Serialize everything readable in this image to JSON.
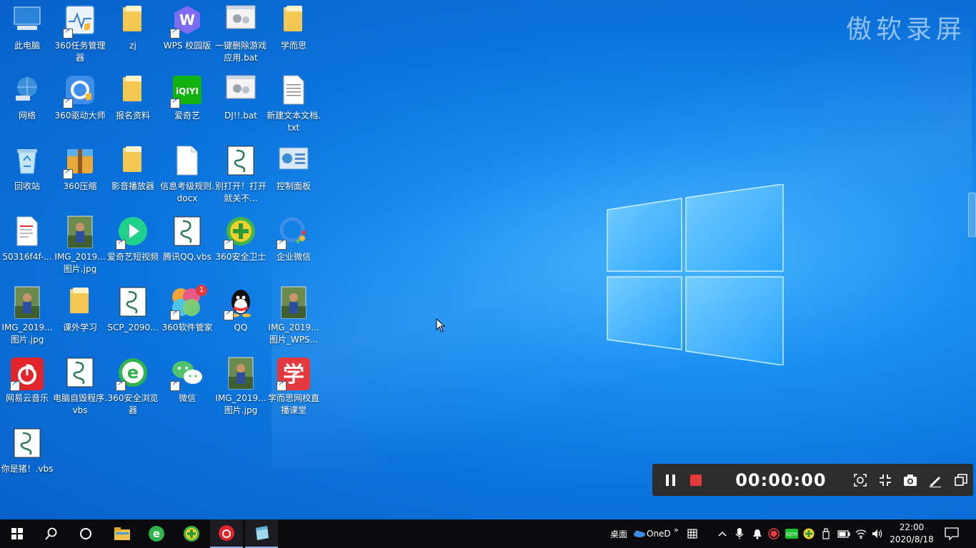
{
  "watermark": "傲软录屏",
  "icons": [
    {
      "label": "此电脑",
      "icon": "computer-icon"
    },
    {
      "label": "360任务管理器",
      "icon": "task-manager-icon"
    },
    {
      "label": "zj",
      "icon": "folder-icon"
    },
    {
      "label": "WPS 校园版",
      "icon": "wps-icon"
    },
    {
      "label": "一键删除游戏应用.bat",
      "icon": "bat-icon"
    },
    {
      "label": "学而思",
      "icon": "folder-icon"
    },
    {
      "label": "网络",
      "icon": "network-icon"
    },
    {
      "label": "360驱动大师",
      "icon": "driver-icon"
    },
    {
      "label": "报名资料",
      "icon": "folder-icon"
    },
    {
      "label": "爱奇艺",
      "icon": "iqiyi-icon"
    },
    {
      "label": "DJ!!.bat",
      "icon": "bat-icon"
    },
    {
      "label": "新建文本文档.txt",
      "icon": "txt-icon"
    },
    {
      "label": "回收站",
      "icon": "recycle-bin-icon"
    },
    {
      "label": "360压缩",
      "icon": "zip-icon"
    },
    {
      "label": "影音播放器",
      "icon": "folder-icon"
    },
    {
      "label": "信息考级规则.docx",
      "icon": "doc-icon"
    },
    {
      "label": "别打开！打开就关不...",
      "icon": "vbs-icon"
    },
    {
      "label": "控制面板",
      "icon": "control-panel-icon"
    },
    {
      "label": "50316f4f-...",
      "icon": "pdf-icon"
    },
    {
      "label": "IMG_2019...图片.jpg",
      "icon": "photo-icon"
    },
    {
      "label": "爱奇艺短视频",
      "icon": "iqiyi-short-icon"
    },
    {
      "label": "腾讯QQ.vbs",
      "icon": "vbs-icon"
    },
    {
      "label": "360安全卫士",
      "icon": "security-guard-icon"
    },
    {
      "label": "企业微信",
      "icon": "wecom-icon"
    },
    {
      "label": "IMG_2019...图片.jpg",
      "icon": "photo-icon"
    },
    {
      "label": "课外学习",
      "icon": "folder-icon"
    },
    {
      "label": "SCP_2090...",
      "icon": "vbs-icon"
    },
    {
      "label": "360软件管家",
      "icon": "software-manager-icon"
    },
    {
      "label": "QQ",
      "icon": "qq-icon"
    },
    {
      "label": "IMG_2019...图片_WPS...",
      "icon": "photo-icon"
    },
    {
      "label": "网易云音乐",
      "icon": "netease-music-icon"
    },
    {
      "label": "电脑自毁程序.vbs",
      "icon": "vbs-icon"
    },
    {
      "label": "360安全浏览器",
      "icon": "browser-icon"
    },
    {
      "label": "微信",
      "icon": "wechat-icon"
    },
    {
      "label": "IMG_2019...图片.jpg",
      "icon": "photo-icon"
    },
    {
      "label": "学而思网校直播课堂",
      "icon": "xueersi-icon"
    },
    {
      "label": "你是猪！.vbs",
      "icon": "vbs-icon"
    }
  ],
  "software_manager_badge": "1",
  "recorder": {
    "time": "00:00:00"
  },
  "taskbar": {
    "desktop_label": "桌面",
    "onedrive_label": "OneD",
    "clock_time": "22:00",
    "clock_date": "2020/8/18"
  }
}
